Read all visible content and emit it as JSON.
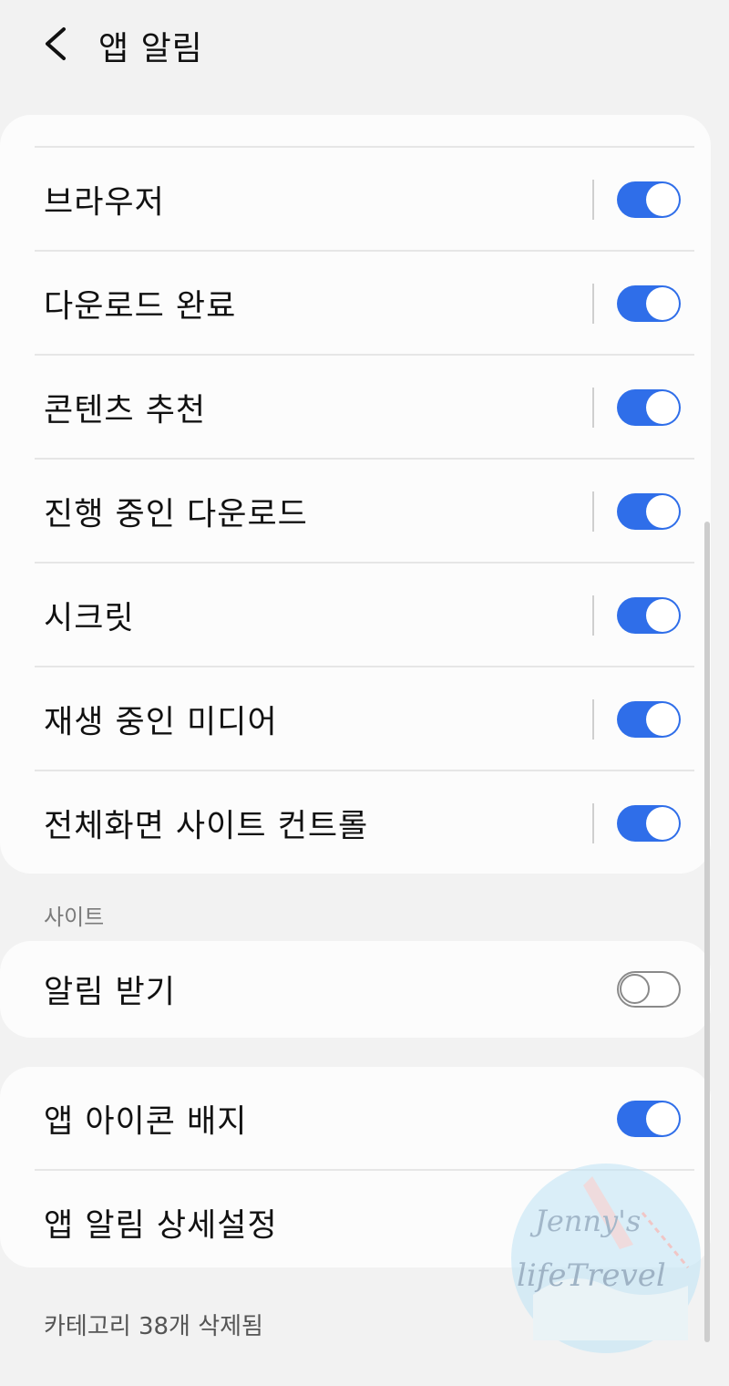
{
  "header": {
    "title": "앱 알림",
    "back_icon": "chevron-left-icon"
  },
  "colors": {
    "accent": "#2f6ee9",
    "background": "#f2f2f2",
    "card": "#fcfcfc"
  },
  "categories": [
    {
      "label": "브라우저",
      "enabled": true
    },
    {
      "label": "다운로드 완료",
      "enabled": true
    },
    {
      "label": "콘텐츠 추천",
      "enabled": true
    },
    {
      "label": "진행 중인 다운로드",
      "enabled": true
    },
    {
      "label": "시크릿",
      "enabled": true
    },
    {
      "label": "재생 중인 미디어",
      "enabled": true
    },
    {
      "label": "전체화면 사이트 컨트롤",
      "enabled": true
    }
  ],
  "sites": {
    "section_title": "사이트",
    "receive_label": "알림 받기",
    "receive_enabled": false
  },
  "more": {
    "badge_label": "앱 아이콘 배지",
    "badge_enabled": true,
    "advanced_label": "앱 알림 상세설정"
  },
  "footer": {
    "deleted_text": "카테고리 38개 삭제됨"
  },
  "watermark": {
    "line1": "Jenny's",
    "line2": "lifeTrevel"
  }
}
